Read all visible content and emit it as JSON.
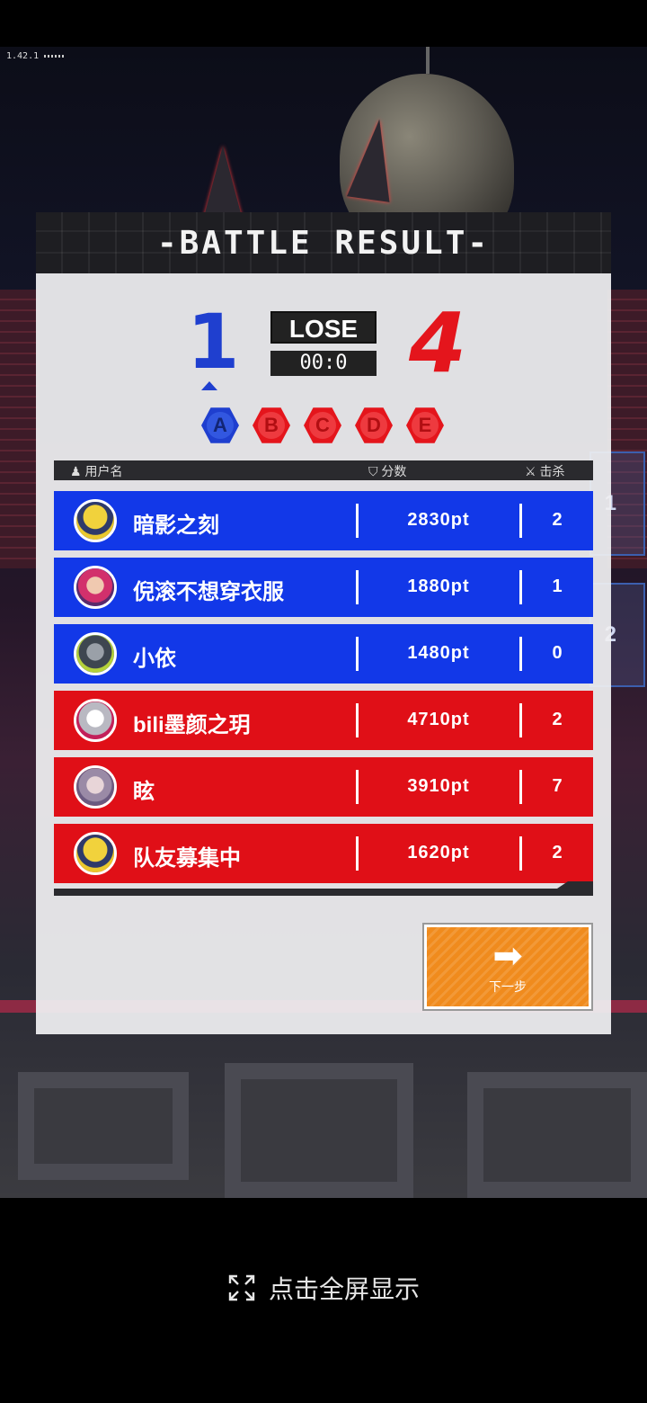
{
  "version": "1.42.1",
  "result": {
    "title": "-BATTLE RESULT-",
    "team_score": "1",
    "enemy_score": "4",
    "status": "LOSE",
    "timer": "00:0"
  },
  "rounds": [
    "A",
    "B",
    "C",
    "D",
    "E"
  ],
  "side_tabs": [
    "1",
    "2"
  ],
  "columns": {
    "user": "用户名",
    "score": "分数",
    "kills": "击杀"
  },
  "players": [
    {
      "name": "暗影之刻",
      "score": "2830pt",
      "kills": "2",
      "team": "blue"
    },
    {
      "name": "倪滚不想穿衣服",
      "score": "1880pt",
      "kills": "1",
      "team": "blue"
    },
    {
      "name": "小依",
      "score": "1480pt",
      "kills": "0",
      "team": "blue"
    },
    {
      "name": "bili墨颜之玥",
      "score": "4710pt",
      "kills": "2",
      "team": "red"
    },
    {
      "name": "眩",
      "score": "3910pt",
      "kills": "7",
      "team": "red"
    },
    {
      "name": "队友募集中",
      "score": "1620pt",
      "kills": "2",
      "team": "red"
    }
  ],
  "next_button": {
    "icon": "➡",
    "label": "下一步"
  },
  "fullscreen": {
    "label": "点击全屏显示"
  },
  "colors": {
    "blue_team": "#1238e8",
    "red_team": "#e00f17",
    "accent": "#f08b1d"
  }
}
